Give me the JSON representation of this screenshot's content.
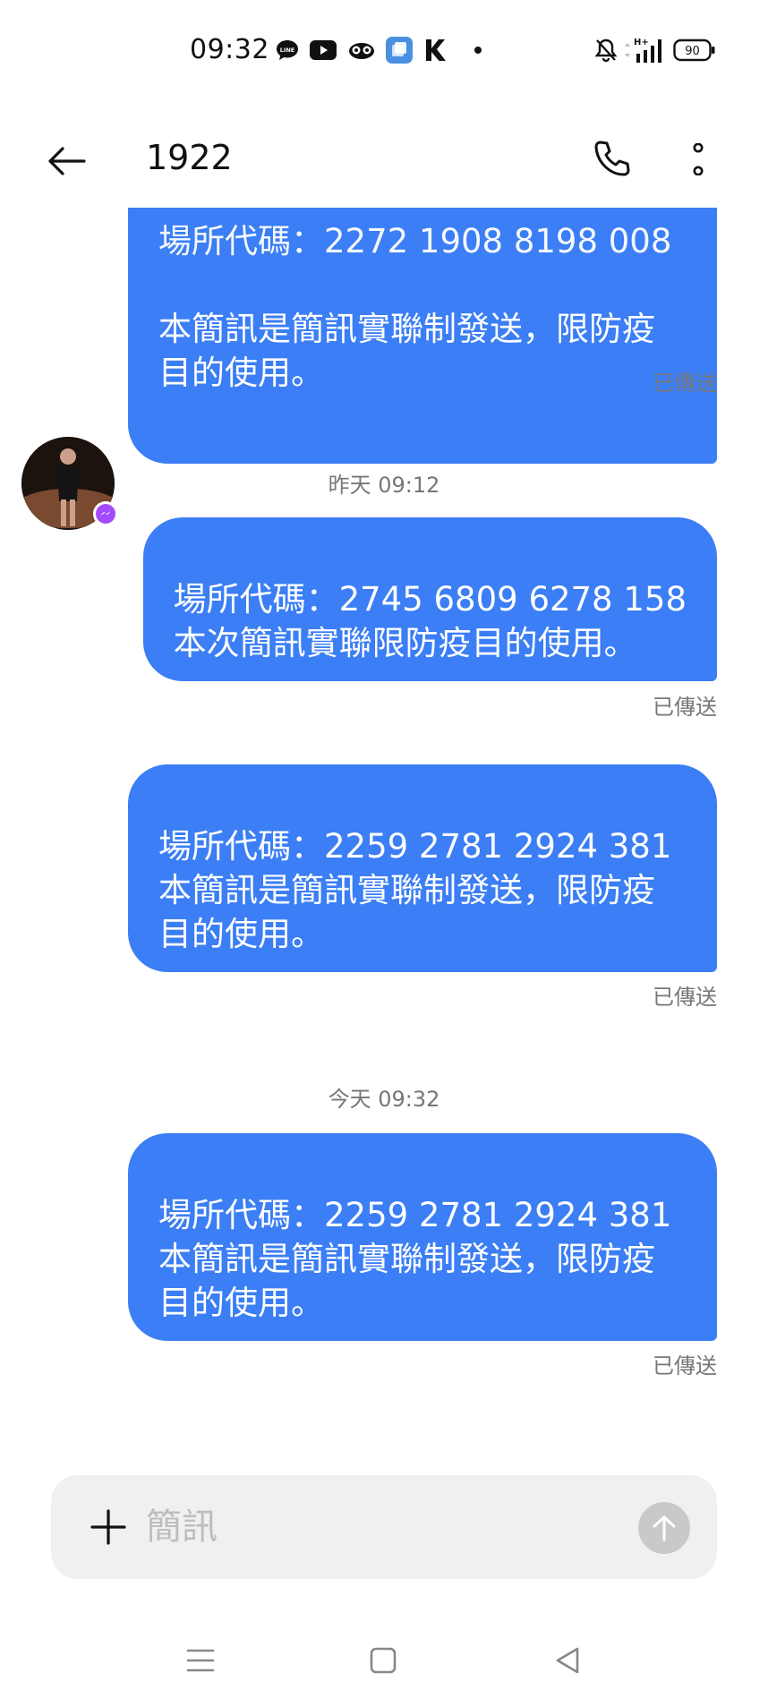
{
  "status_bar": {
    "time": "09:32",
    "battery": "90",
    "network": "H+",
    "icons": [
      "line-app-icon",
      "youtube-icon",
      "owl-app-icon",
      "multi-window-icon",
      "k-app-icon",
      "notification-dot-icon",
      "bell-muted-icon",
      "signal-icon",
      "battery-icon"
    ]
  },
  "header": {
    "title": "1922"
  },
  "messages": [
    {
      "text": "本簡訊是簡訊實聯制發送，限防疫\n目的使用。",
      "partial_top": "場所代碼：2272 1908 8198 008",
      "status": "已傳送"
    },
    {
      "timestamp": "昨天 09:12",
      "text": "場所代碼：2745 6809 6278 158\n本次簡訊實聯限防疫目的使用。",
      "status": "已傳送"
    },
    {
      "text": "場所代碼：2259 2781 2924 381\n本簡訊是簡訊實聯制發送，限防疫\n目的使用。",
      "status": "已傳送"
    },
    {
      "timestamp": "今天 09:32",
      "text": "場所代碼：2259 2781 2924 381\n本簡訊是簡訊實聯制發送，限防疫\n目的使用。",
      "status": "已傳送"
    }
  ],
  "composer": {
    "placeholder": "簡訊",
    "value": ""
  },
  "colors": {
    "bubble": "#3b7ef5",
    "meta_text": "#777777",
    "input_bg": "#f0f0f0"
  }
}
